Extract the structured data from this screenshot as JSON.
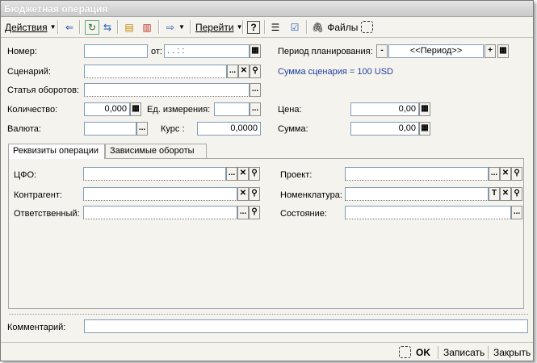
{
  "window": {
    "title": "Бюджетная операция"
  },
  "toolbar": {
    "actions_label": "Действия",
    "goto_label": "Перейти",
    "files_label": "Файлы",
    "help_label": "?"
  },
  "form": {
    "number_label": "Номер:",
    "number_value": "",
    "from_label": "от:",
    "date_value": ".   .        :   :",
    "period_label": "Период планирования:",
    "period_value": "<<Период>>",
    "scenario_label": "Сценарий:",
    "scenario_value": "",
    "scenario_sum": "Сумма сценария = 100 USD",
    "turnover_label": "Статья оборотов:",
    "turnover_value": "",
    "quantity_label": "Количество:",
    "quantity_value": "0,000",
    "unit_label": "Ед. измерения:",
    "unit_value": "",
    "price_label": "Цена:",
    "price_value": "0,00",
    "currency_label": "Валюта:",
    "currency_value": "",
    "rate_label": "Курс :",
    "rate_value": "0,0000",
    "sum_label": "Сумма:",
    "sum_value": "0,00",
    "comment_label": "Комментарий:",
    "comment_value": ""
  },
  "tabs": [
    {
      "label": "Реквизиты операции"
    },
    {
      "label": "Зависимые обороты"
    }
  ],
  "details": {
    "cfo_label": "ЦФО:",
    "cfo_value": "",
    "project_label": "Проект:",
    "project_value": "",
    "counterparty_label": "Контрагент:",
    "counterparty_value": "",
    "nomenclature_label": "Номенклатура:",
    "nomenclature_value": "",
    "responsible_label": "Ответственный:",
    "responsible_value": "",
    "state_label": "Состояние:",
    "state_value": ""
  },
  "footer": {
    "ok_label": "OK",
    "save_label": "Записать",
    "close_label": "Закрыть"
  },
  "icons": {
    "ellipsis": "...",
    "clear": "✕",
    "search": "🔍",
    "minus": "-",
    "plus": "+",
    "text": "T"
  }
}
